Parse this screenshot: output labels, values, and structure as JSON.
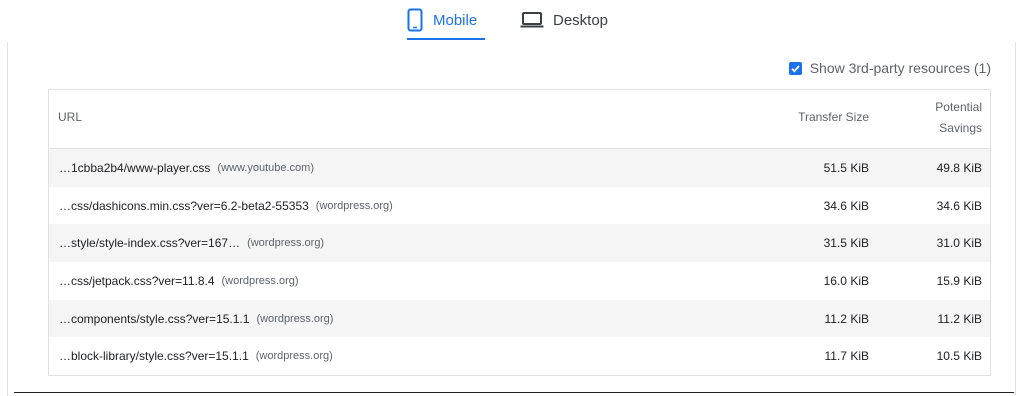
{
  "tabs": [
    {
      "label": "Mobile",
      "icon": "smartphone-icon",
      "active": true
    },
    {
      "label": "Desktop",
      "icon": "laptop-icon",
      "active": false
    }
  ],
  "third_party": {
    "label": "Show 3rd-party resources (1)",
    "checked": true
  },
  "table": {
    "headers": {
      "url": "URL",
      "transfer_size": "Transfer Size",
      "potential_savings_line1": "Potential",
      "potential_savings_line2": "Savings"
    },
    "rows": [
      {
        "url": "…1cbba2b4/www-player.css",
        "origin": "(www.youtube.com)",
        "size": "51.5 KiB",
        "savings": "49.8 KiB"
      },
      {
        "url": "…css/dashicons.min.css?ver=6.2-beta2-55353",
        "origin": "(wordpress.org)",
        "size": "34.6 KiB",
        "savings": "34.6 KiB"
      },
      {
        "url": "…style/style-index.css?ver=167…",
        "origin": "(wordpress.org)",
        "size": "31.5 KiB",
        "savings": "31.0 KiB"
      },
      {
        "url": "…css/jetpack.css?ver=11.8.4",
        "origin": "(wordpress.org)",
        "size": "16.0 KiB",
        "savings": "15.9 KiB"
      },
      {
        "url": "…components/style.css?ver=15.1.1",
        "origin": "(wordpress.org)",
        "size": "11.2 KiB",
        "savings": "11.2 KiB"
      },
      {
        "url": "…block-library/style.css?ver=15.1.1",
        "origin": "(wordpress.org)",
        "size": "11.7 KiB",
        "savings": "10.5 KiB"
      }
    ]
  },
  "colors": {
    "accent": "#1a73e8",
    "row_alt": "#f5f5f5",
    "border": "#e0e0e0"
  }
}
